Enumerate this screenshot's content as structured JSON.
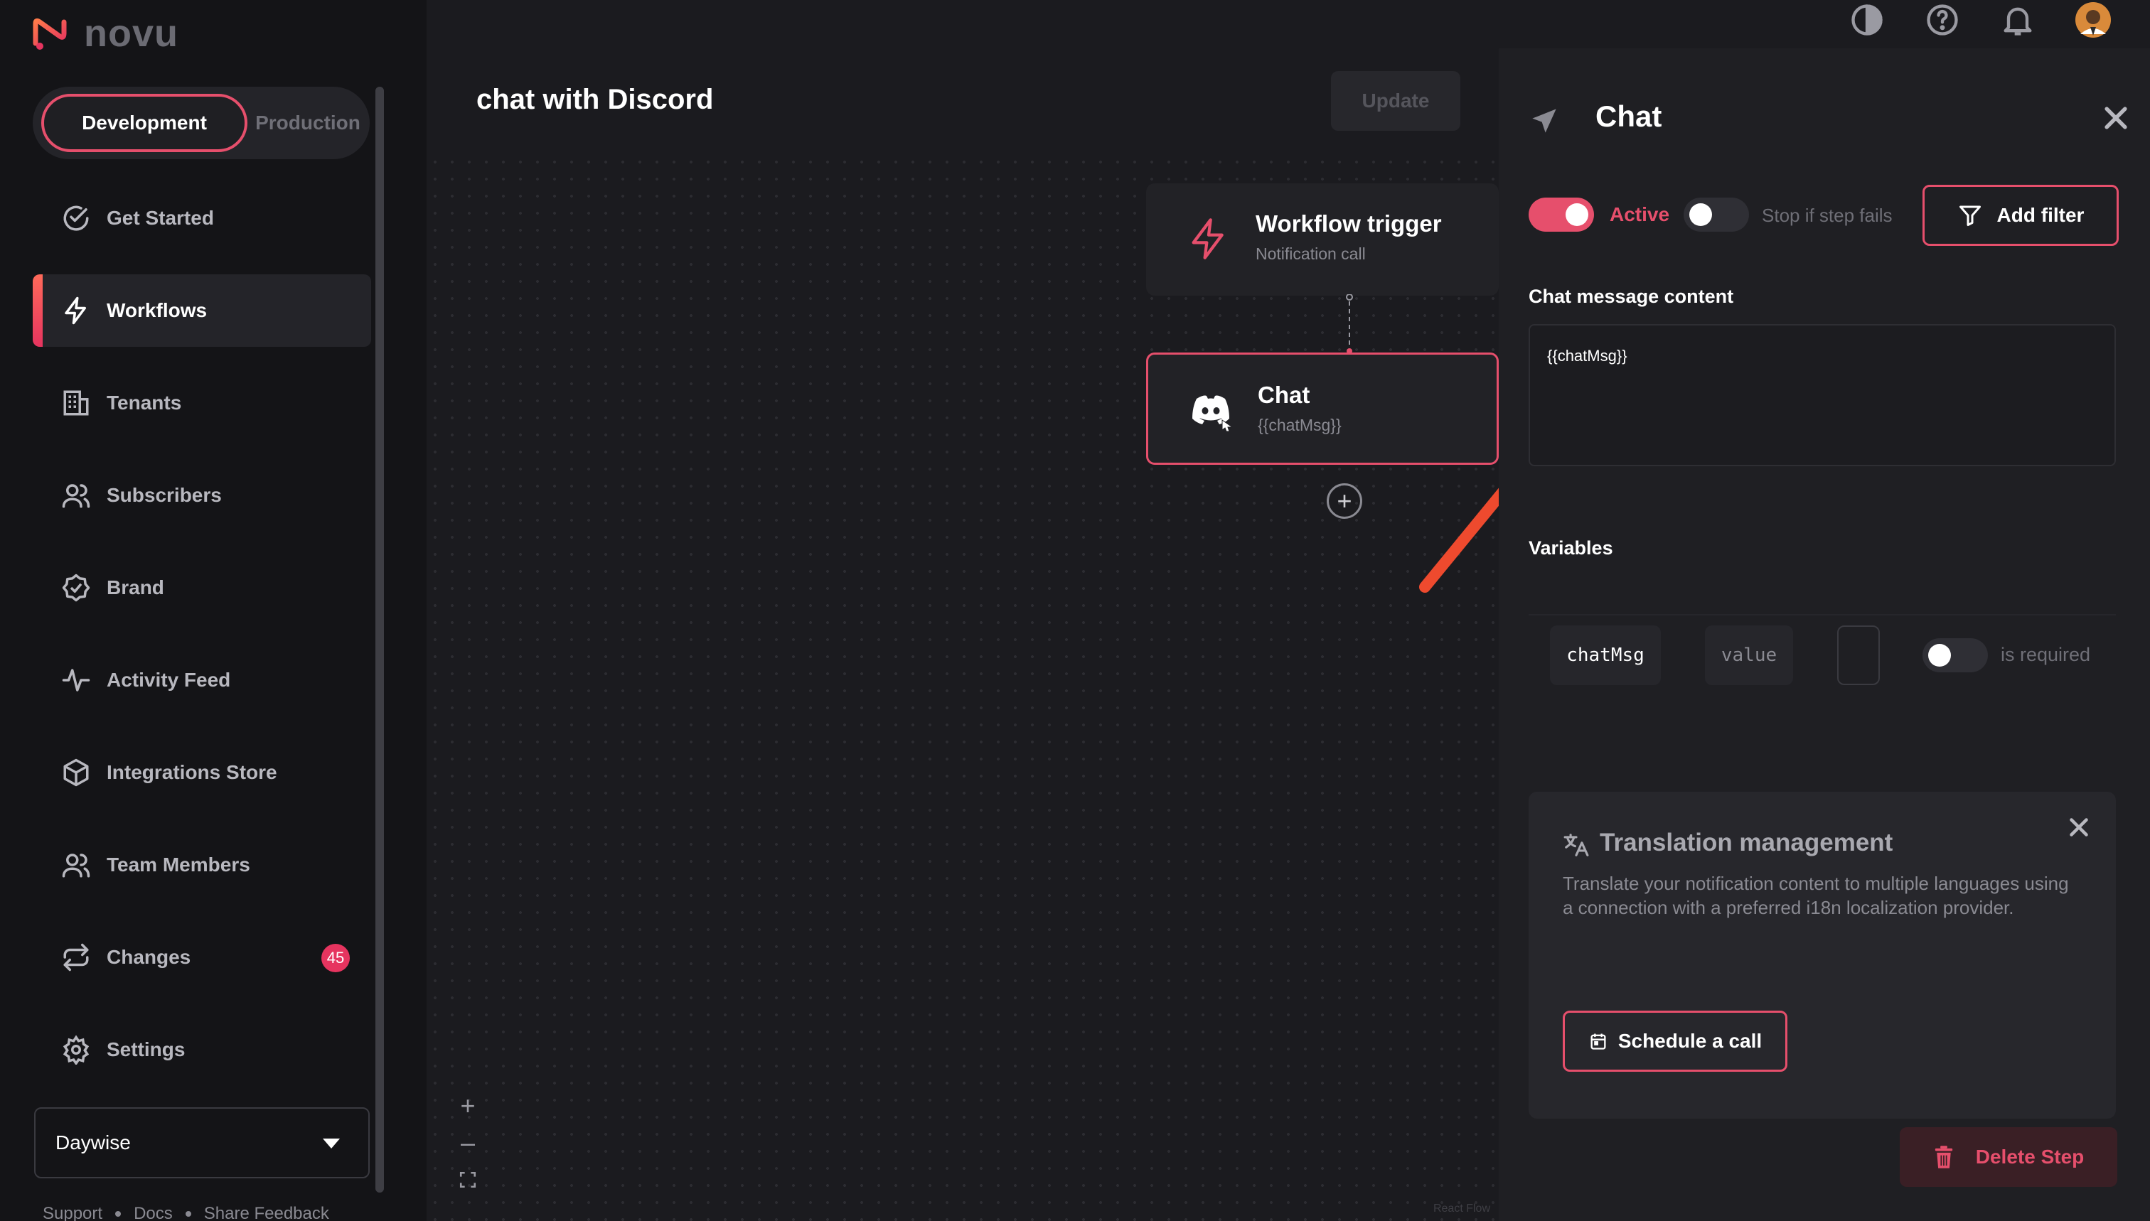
{
  "app": {
    "name": "novu"
  },
  "environment": {
    "development_label": "Development",
    "production_label": "Production",
    "selected": "Development"
  },
  "sidebar": {
    "items": [
      {
        "label": "Get Started",
        "icon": "check-circle-icon"
      },
      {
        "label": "Workflows",
        "icon": "bolt-icon",
        "active": true
      },
      {
        "label": "Tenants",
        "icon": "building-icon"
      },
      {
        "label": "Subscribers",
        "icon": "users-icon"
      },
      {
        "label": "Brand",
        "icon": "badge-check-icon"
      },
      {
        "label": "Activity Feed",
        "icon": "activity-icon"
      },
      {
        "label": "Integrations Store",
        "icon": "box-icon"
      },
      {
        "label": "Team Members",
        "icon": "team-icon"
      },
      {
        "label": "Changes",
        "icon": "sync-icon",
        "badge": "45"
      },
      {
        "label": "Settings",
        "icon": "gear-icon"
      }
    ],
    "organization": "Daywise",
    "footer": {
      "support": "Support",
      "docs": "Docs",
      "feedback": "Share Feedback"
    }
  },
  "canvas": {
    "workflow_name": "chat with Discord",
    "update_label": "Update",
    "nodes": {
      "trigger": {
        "title": "Workflow trigger",
        "subtitle": "Notification call"
      },
      "chat": {
        "title": "Chat",
        "subtitle": "{{chatMsg}}"
      }
    },
    "zoom": {
      "in": "+",
      "out": "–"
    },
    "attribution": "React Flow"
  },
  "panel": {
    "title": "Chat",
    "active_label": "Active",
    "active_on": true,
    "stop_label": "Stop if step fails",
    "stop_on": false,
    "add_filter_label": "Add filter",
    "content_label": "Chat message content",
    "content_value": "{{chatMsg}}",
    "variables_label": "Variables",
    "variable": {
      "name": "chatMsg",
      "value_placeholder": "value",
      "required_label": "is required",
      "required_on": false
    },
    "translation": {
      "title": "Translation management",
      "description": "Translate your notification content to multiple languages using a connection with a preferred i18n localization provider.",
      "button_label": "Schedule a call"
    },
    "delete_label": "Delete Step"
  },
  "colors": {
    "accent": "#e64f6c",
    "background": "#1b1b1f",
    "sidebar": "#141417",
    "panel": "#1f1f23",
    "annotation_arrow": "#ee4a2e"
  }
}
